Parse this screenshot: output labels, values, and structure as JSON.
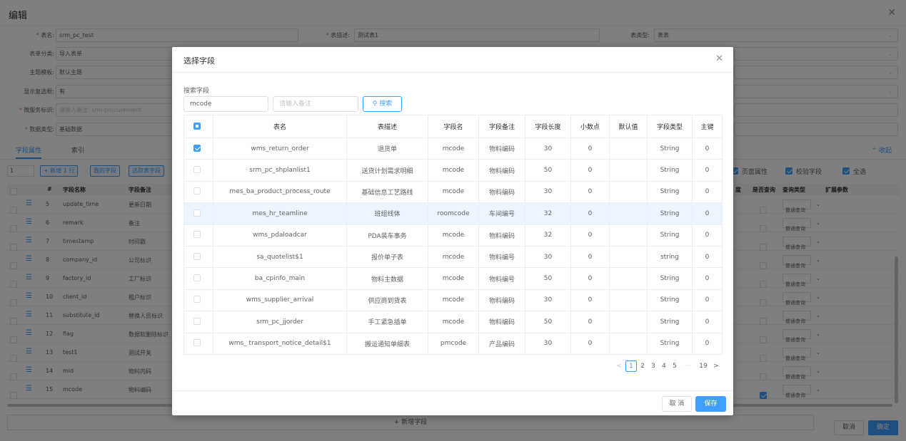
{
  "background": {
    "title": "编辑",
    "form": {
      "table_name_label": "表名:",
      "table_name_value": "srm_pc_test",
      "table_desc_label": "表描述:",
      "table_desc_value": "测试表1",
      "table_type_label": "表类型:",
      "table_type_value": "表表",
      "form_category_label": "表单分类:",
      "form_category_value": "导入表单",
      "theme_label": "主题模板:",
      "theme_value": "默认主题",
      "show_checkbox_label": "显示复选框:",
      "show_checkbox_value": "有",
      "microservice_label": "微服务标识:",
      "microservice_value": "请输入备注: srm-procurement",
      "data_type_label": "数据类型:",
      "data_type_value": "基础数据"
    },
    "tabs": [
      "字段属性",
      "索引"
    ],
    "collapse_label": "收起",
    "toolbar": {
      "row_count": "1",
      "add_row": "+ 新增 1 行",
      "my_fields": "我的字段",
      "pick_table_fields": "选取表字段",
      "page_attr": "页面属性",
      "validate_field": "校验字段",
      "select_all": "全选"
    },
    "table_headers": {
      "num": "#",
      "field_name": "字段名称",
      "field_remark": "字段备注",
      "col_density": "度",
      "is_query": "是否查询",
      "query_type": "查询类型",
      "ext_params": "扩展参数"
    },
    "rows": [
      {
        "no": "5",
        "name": "update_time",
        "remark": "更新日期",
        "query": "普通查询",
        "checked": false
      },
      {
        "no": "6",
        "name": "remark",
        "remark": "备注",
        "query": "普通查询",
        "checked": false
      },
      {
        "no": "7",
        "name": "timestamp",
        "remark": "时间戳",
        "query": "普通查询",
        "checked": false
      },
      {
        "no": "8",
        "name": "company_id",
        "remark": "公司标识",
        "query": "普通查询",
        "checked": false
      },
      {
        "no": "9",
        "name": "factory_id",
        "remark": "工厂标识",
        "query": "普通查询",
        "checked": false
      },
      {
        "no": "10",
        "name": "client_id",
        "remark": "租户标识",
        "query": "普通查询",
        "checked": false
      },
      {
        "no": "11",
        "name": "substitute_id",
        "remark": "替换人员标识",
        "query": "普通查询",
        "checked": false
      },
      {
        "no": "12",
        "name": "flag",
        "remark": "数据软删除标识",
        "query": "普通查询",
        "checked": false
      },
      {
        "no": "13",
        "name": "test1",
        "remark": "测试开关",
        "query": "普通查询",
        "checked": false
      },
      {
        "no": "14",
        "name": "mid",
        "remark": "物料内码",
        "query": "普通查询",
        "checked": false
      },
      {
        "no": "15",
        "name": "mcode",
        "remark": "物料编码",
        "query": "普通查询",
        "checked": true
      }
    ],
    "add_field": "+ 新增字段",
    "cancel": "取消",
    "confirm": "确定"
  },
  "dialog": {
    "title": "选择字段",
    "search_label": "搜索字段",
    "field_input_value": "mcode",
    "remark_input_placeholder": "请输入备注",
    "search_button": "搜索",
    "columns": [
      "表名",
      "表描述",
      "字段名",
      "字段备注",
      "字段长度",
      "小数点",
      "默认值",
      "字段类型",
      "主键"
    ],
    "rows": [
      {
        "checked": true,
        "table": "wms_return_order",
        "desc": "退货单",
        "field": "mcode",
        "remark": "物料编码",
        "length": "30",
        "decimal": "0",
        "default": "",
        "type": "String",
        "pk": "0"
      },
      {
        "checked": false,
        "table": "srm_pc_shplanlist1",
        "desc": "送货计划需求明细",
        "field": "mcode",
        "remark": "物料编码",
        "length": "50",
        "decimal": "0",
        "default": "",
        "type": "String",
        "pk": "0"
      },
      {
        "checked": false,
        "table": "mes_ba_product_process_route",
        "desc": "基础信息工艺路线",
        "field": "mcode",
        "remark": "物料编码",
        "length": "30",
        "decimal": "0",
        "default": "",
        "type": "String",
        "pk": "0"
      },
      {
        "checked": false,
        "table": "mes_hr_teamline",
        "desc": "班组线体",
        "field": "roomcode",
        "remark": "车间编号",
        "length": "32",
        "decimal": "0",
        "default": "",
        "type": "String",
        "pk": "0"
      },
      {
        "checked": false,
        "table": "wms_pdaloadcar",
        "desc": "PDA装车事务",
        "field": "mcode",
        "remark": "物料编码",
        "length": "32",
        "decimal": "0",
        "default": "",
        "type": "String",
        "pk": "0"
      },
      {
        "checked": false,
        "table": "sa_quotelist$1",
        "desc": "报价单子表",
        "field": "mcode",
        "remark": "物料编号",
        "length": "30",
        "decimal": "0",
        "default": "",
        "type": "string",
        "pk": "0"
      },
      {
        "checked": false,
        "table": "ba_cpinfo_main",
        "desc": "物料主数据",
        "field": "mcode",
        "remark": "物料编号",
        "length": "50",
        "decimal": "0",
        "default": "",
        "type": "String",
        "pk": "0"
      },
      {
        "checked": false,
        "table": "wms_supplier_arrival",
        "desc": "供应商到货表",
        "field": "mcode",
        "remark": "物料编码",
        "length": "30",
        "decimal": "0",
        "default": "",
        "type": "String",
        "pk": "0"
      },
      {
        "checked": false,
        "table": "srm_pc_jjorder",
        "desc": "手工紧急插单",
        "field": "mcode",
        "remark": "物料编码",
        "length": "50",
        "decimal": "0",
        "default": "",
        "type": "String",
        "pk": "0"
      },
      {
        "checked": false,
        "table": "wms_ transport_notice_detail$1",
        "desc": "搬运通知单细表",
        "field": "pmcode",
        "remark": "产品编码",
        "length": "30",
        "decimal": "0",
        "default": "",
        "type": "String",
        "pk": "0"
      }
    ],
    "pager": {
      "prev": "<",
      "pages": [
        "1",
        "2",
        "3",
        "4",
        "5",
        "···",
        "19"
      ],
      "next": ">"
    },
    "cancel": "取 消",
    "save": "保存"
  }
}
